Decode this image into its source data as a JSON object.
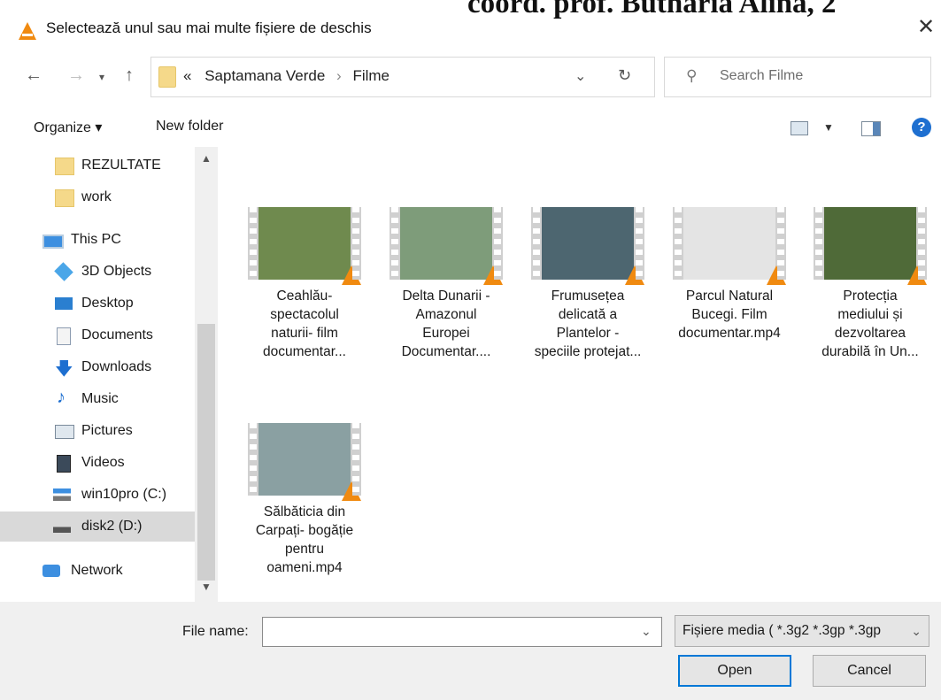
{
  "overlay": {
    "text": "coord. prof. Buthărîa Alina, 2"
  },
  "window": {
    "title": "Selectează unul sau mai multe fișiere de deschis"
  },
  "address": {
    "prefix": "«",
    "crumbs": [
      "Saptamana Verde",
      "Filme"
    ]
  },
  "search": {
    "placeholder": "Search Filme"
  },
  "toolbar": {
    "organize_label": "Organize ▾",
    "new_folder_label": "New folder"
  },
  "nav": {
    "items": [
      {
        "label": "REZULTATE",
        "icon": "folder-icon"
      },
      {
        "label": "work",
        "icon": "folder-icon"
      },
      {
        "label": "This PC",
        "icon": "computer-icon"
      },
      {
        "label": "3D Objects",
        "icon": "cube-icon"
      },
      {
        "label": "Desktop",
        "icon": "desktop-icon"
      },
      {
        "label": "Documents",
        "icon": "documents-icon"
      },
      {
        "label": "Downloads",
        "icon": "download-icon"
      },
      {
        "label": "Music",
        "icon": "music-icon"
      },
      {
        "label": "Pictures",
        "icon": "pictures-icon"
      },
      {
        "label": "Videos",
        "icon": "videos-icon"
      },
      {
        "label": "win10pro (C:)",
        "icon": "drive-icon"
      },
      {
        "label": "disk2 (D:)",
        "icon": "drive-icon"
      },
      {
        "label": "Network",
        "icon": "network-icon"
      }
    ]
  },
  "files": [
    {
      "name": "Ceahlău-\nspectacolul\nnaturii- film\ndocumentar...",
      "thumb_color": "#6f8a4e"
    },
    {
      "name": "Delta Dunarii -\nAmazonul\nEuropei\nDocumentar....",
      "thumb_color": "#7e9c7a"
    },
    {
      "name": "Frumusețea\ndelicată a\nPlantelor -\nspeciile protejat...",
      "thumb_color": "#4d6670"
    },
    {
      "name": "Parcul Natural\nBucegi. Film\ndocumentar.mp4",
      "thumb_color": "#e4e4e4"
    },
    {
      "name": "Protecția\nmediului și\ndezvoltarea\ndurabilă în Un...",
      "thumb_color": "#4f6a38"
    },
    {
      "name": "Sălbăticia din\nCarpați- bogăție\npentru\noameni.mp4",
      "thumb_color": "#8aa0a2"
    }
  ],
  "bottom": {
    "file_name_label": "File name:",
    "file_name_value": "",
    "filter_label": "Fișiere media ( *.3g2 *.3gp *.3gp",
    "open_label": "Open",
    "cancel_label": "Cancel"
  },
  "colors": {
    "accent": "#0078d7",
    "selected": "#d9d9d9",
    "vlc_orange": "#f08a10"
  }
}
